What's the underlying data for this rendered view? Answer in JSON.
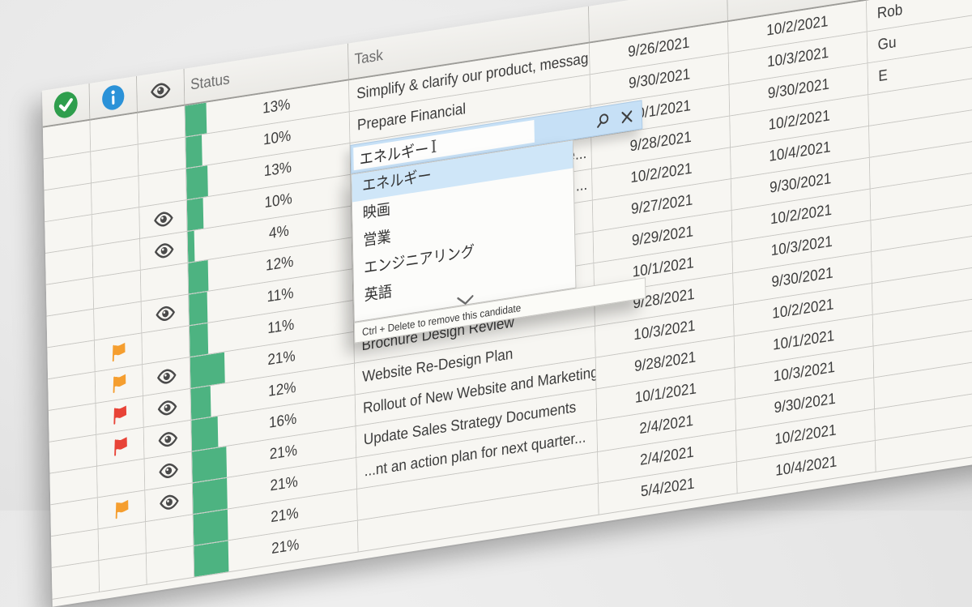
{
  "grid": {
    "colors": {
      "progress_green": "#4db381",
      "check_green": "#2f9e4d",
      "info_blue": "#2b92d8",
      "flag_orange": "#f59e2f",
      "flag_red": "#e84337",
      "icon_gray": "#4a4a4a",
      "selection_blue": "#cfe6f8",
      "band_blue": "#c6e0f6"
    },
    "header": {
      "check_icon": "check-circle",
      "info_icon": "info-circle",
      "eye_icon": "eye",
      "status_label": "Status",
      "task_label": "Task"
    },
    "rows": [
      {
        "pct": 13,
        "flag": null,
        "eye": false,
        "task": "Simplify & clarify our product, messagi...",
        "start": "9/26/2021",
        "end": "10/2/2021",
        "owner": "Rob"
      },
      {
        "pct": 10,
        "flag": null,
        "eye": false,
        "task": "Prepare Financial",
        "start": "9/30/2021",
        "end": "10/3/2021",
        "owner": "Gu"
      },
      {
        "pct": 13,
        "flag": null,
        "eye": false,
        "task": "",
        "start": "10/1/2021",
        "end": "9/30/2021",
        "owner": "E"
      },
      {
        "pct": 10,
        "flag": null,
        "eye": true,
        "task": "e...",
        "tail": true,
        "start": "9/28/2021",
        "end": "10/2/2021",
        "owner": ""
      },
      {
        "pct": 4,
        "flag": null,
        "eye": true,
        "task": "...",
        "tail": true,
        "start": "10/2/2021",
        "end": "10/4/2021",
        "owner": ""
      },
      {
        "pct": 12,
        "flag": null,
        "eye": false,
        "task": "",
        "start": "9/27/2021",
        "end": "9/30/2021",
        "owner": ""
      },
      {
        "pct": 11,
        "flag": null,
        "eye": true,
        "task": "",
        "start": "9/29/2021",
        "end": "10/2/2021",
        "owner": ""
      },
      {
        "pct": 11,
        "flag": "orange",
        "eye": false,
        "task": "",
        "start": "10/1/2021",
        "end": "10/3/2021",
        "owner": ""
      },
      {
        "pct": 21,
        "flag": "orange",
        "eye": true,
        "task": "Brochure Design Review",
        "start": "9/28/2021",
        "end": "9/30/2021",
        "owner": ""
      },
      {
        "pct": 12,
        "flag": "red",
        "eye": true,
        "task": "Website Re-Design Plan",
        "start": "10/3/2021",
        "end": "10/2/2021",
        "owner": ""
      },
      {
        "pct": 16,
        "flag": "red",
        "eye": true,
        "task": "Rollout of New Website and Marketing...",
        "start": "9/28/2021",
        "end": "10/1/2021",
        "owner": ""
      },
      {
        "pct": 21,
        "flag": null,
        "eye": true,
        "task": "Update Sales Strategy Documents",
        "start": "10/1/2021",
        "end": "10/3/2021",
        "owner": ""
      },
      {
        "pct": 21,
        "flag": "orange",
        "eye": true,
        "task": "...nt an action plan for next quarter...",
        "start": "2/4/2021",
        "end": "9/30/2021",
        "owner": ""
      },
      {
        "pct": 21,
        "flag": null,
        "eye": false,
        "task": "",
        "start": "2/4/2021",
        "end": "10/2/2021",
        "owner": ""
      },
      {
        "pct": 21,
        "flag": null,
        "eye": false,
        "task": "",
        "start": "5/4/2021",
        "end": "10/4/2021",
        "owner": ""
      }
    ]
  },
  "editor": {
    "value": "エネルギー",
    "search_icon": "magnifier",
    "close_icon": "close-x"
  },
  "popup": {
    "items": [
      "エネルギー",
      "映画",
      "営業",
      "エンジニアリング",
      "英語"
    ],
    "selected_index": 0,
    "chevron_icon": "chevron-down",
    "footer_hint": "Ctrl + Delete to remove this candidate"
  }
}
